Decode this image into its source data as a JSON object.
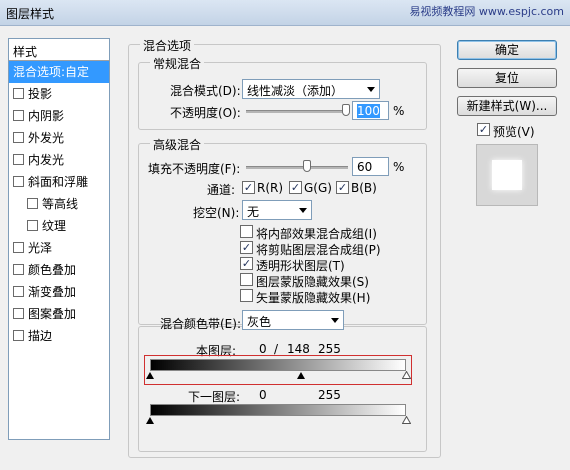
{
  "window": {
    "title": "图层样式",
    "watermark": "易视频教程网 www.espjc.com"
  },
  "stylelist": {
    "header": "样式",
    "items": [
      {
        "label": "混合选项:自定",
        "selected": true,
        "checkbox": false,
        "indent": false
      },
      {
        "label": "投影",
        "checkbox": true,
        "indent": false
      },
      {
        "label": "内阴影",
        "checkbox": true,
        "indent": false
      },
      {
        "label": "外发光",
        "checkbox": true,
        "indent": false
      },
      {
        "label": "内发光",
        "checkbox": true,
        "indent": false
      },
      {
        "label": "斜面和浮雕",
        "checkbox": true,
        "indent": false
      },
      {
        "label": "等高线",
        "checkbox": true,
        "indent": true
      },
      {
        "label": "纹理",
        "checkbox": true,
        "indent": true
      },
      {
        "label": "光泽",
        "checkbox": true,
        "indent": false
      },
      {
        "label": "颜色叠加",
        "checkbox": true,
        "indent": false
      },
      {
        "label": "渐变叠加",
        "checkbox": true,
        "indent": false
      },
      {
        "label": "图案叠加",
        "checkbox": true,
        "indent": false
      },
      {
        "label": "描边",
        "checkbox": true,
        "indent": false
      }
    ]
  },
  "blend": {
    "section_title": "混合选项",
    "general_title": "常规混合",
    "mode_label": "混合模式(D):",
    "mode_value": "线性减淡（添加）",
    "opacity_label": "不透明度(O):",
    "opacity_value": "100",
    "opacity_unit": "%",
    "opacity_level": 1.0,
    "advanced_title": "高级混合",
    "fill_label": "填充不透明度(F):",
    "fill_value": "60",
    "fill_unit": "%",
    "fill_level": 0.6,
    "channels_label": "通道:",
    "channel_r": "R(R)",
    "channel_g": "G(G)",
    "channel_b": "B(B)",
    "knockout_label": "挖空(N):",
    "knockout_value": "无",
    "options": [
      {
        "label": "将内部效果混合成组(I)",
        "checked": false
      },
      {
        "label": "将剪贴图层混合成组(P)",
        "checked": true
      },
      {
        "label": "透明形状图层(T)",
        "checked": true
      },
      {
        "label": "图层蒙版隐藏效果(S)",
        "checked": false
      },
      {
        "label": "矢量蒙版隐藏效果(H)",
        "checked": false
      }
    ],
    "blendif_label": "混合颜色带(E):",
    "blendif_value": "灰色",
    "this_layer_label": "本图层:",
    "this_layer_low": "0",
    "this_layer_sep": "/",
    "this_layer_split": "148",
    "this_layer_high": "255",
    "under_layer_label": "下一图层:",
    "under_layer_low": "0",
    "under_layer_high": "255"
  },
  "buttons": {
    "ok": "确定",
    "reset": "复位",
    "new_style": "新建样式(W)...",
    "preview": "预览(V)"
  },
  "colors": {
    "selection": "#3399ff",
    "highlight_box": "#d03030"
  }
}
